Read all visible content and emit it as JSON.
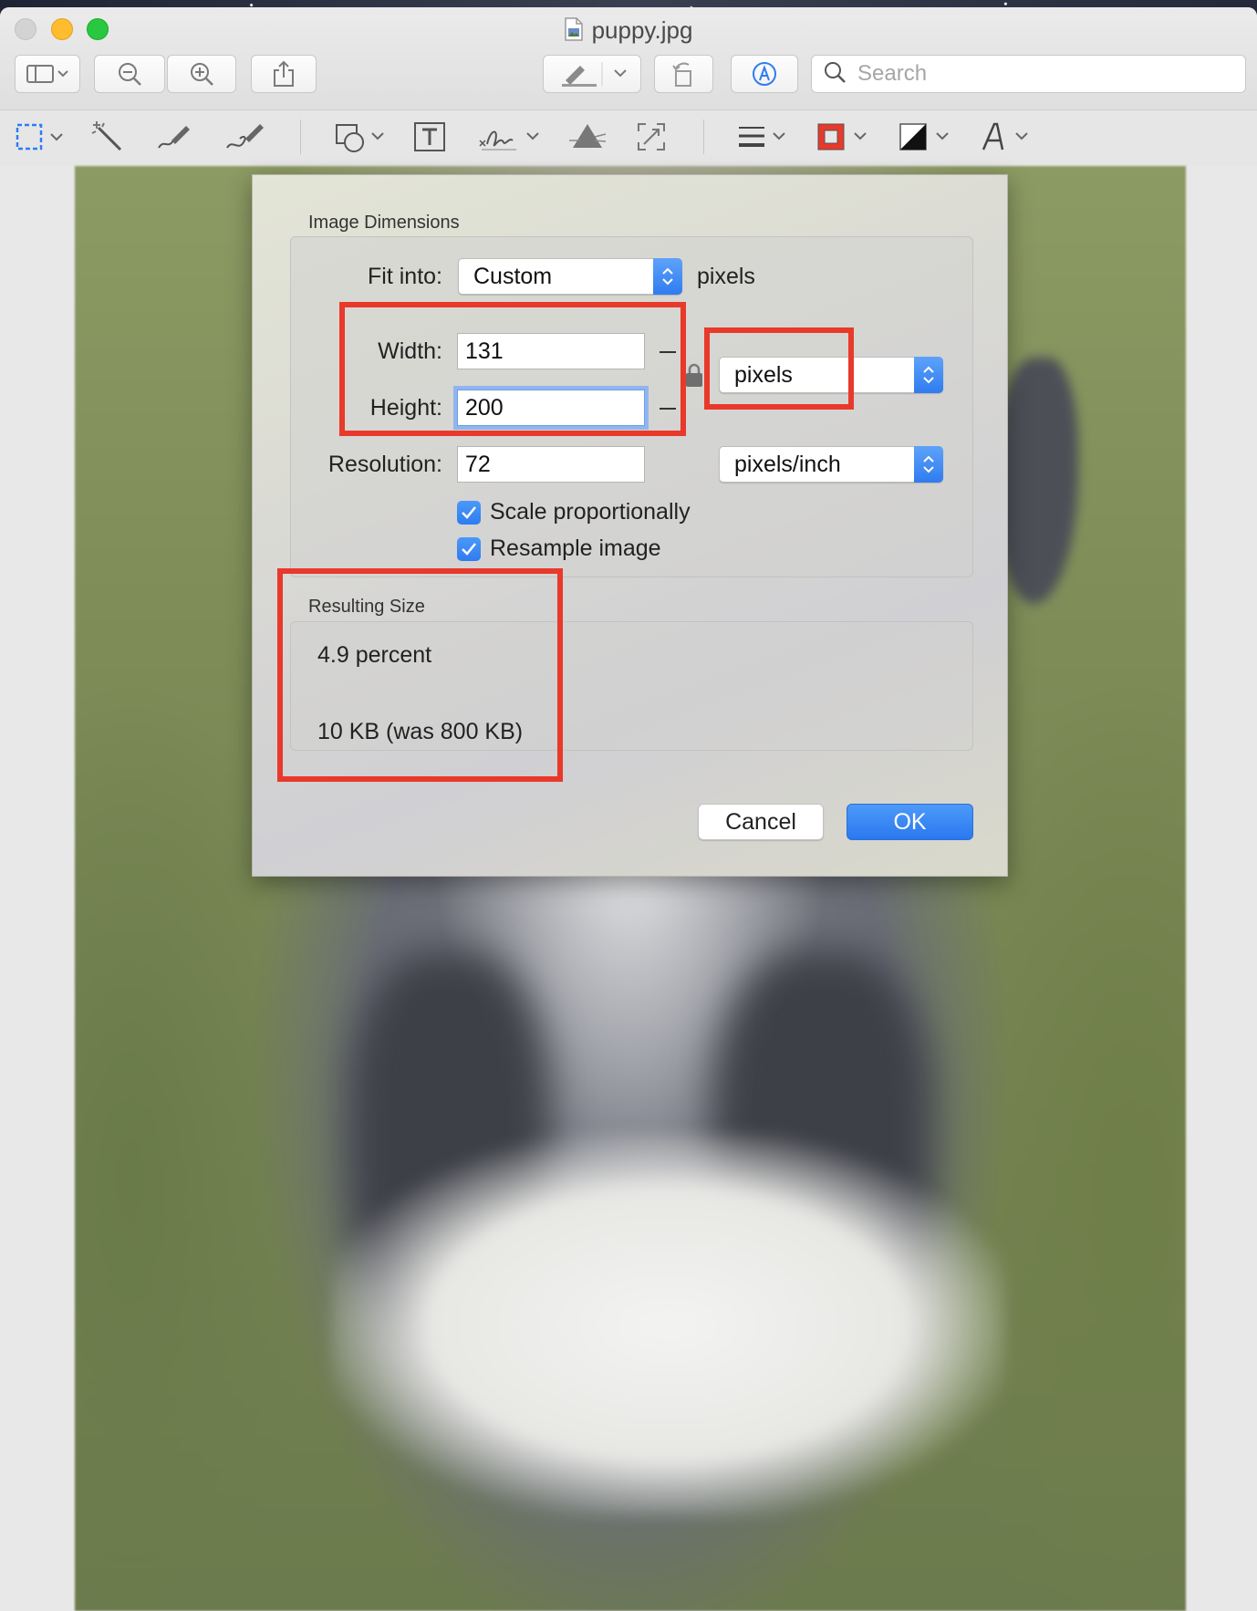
{
  "window": {
    "title": "puppy.jpg"
  },
  "toolbar": {
    "search_placeholder": "Search"
  },
  "dialog": {
    "image_dimensions_title": "Image Dimensions",
    "fit_into_label": "Fit into:",
    "fit_into_value": "Custom",
    "fit_into_unit": "pixels",
    "width_label": "Width:",
    "width_value": "131",
    "height_label": "Height:",
    "height_value": "200",
    "size_unit_value": "pixels",
    "resolution_label": "Resolution:",
    "resolution_value": "72",
    "resolution_unit_value": "pixels/inch",
    "scale_proportionally_label": "Scale proportionally",
    "scale_proportionally_checked": true,
    "resample_image_label": "Resample image",
    "resample_image_checked": true,
    "resulting_size_title": "Resulting Size",
    "result_percent": "4.9 percent",
    "result_filesize": "10 KB (was 800 KB)",
    "cancel_label": "Cancel",
    "ok_label": "OK"
  },
  "colors": {
    "accent": "#2f7cf0",
    "annotation_red": "#e8392a"
  },
  "icons": {
    "sidebar": "sidebar-icon",
    "zoom_out": "zoom-out-icon",
    "zoom_in": "zoom-in-icon",
    "share": "share-icon",
    "markup_pen": "pen-icon",
    "rotate": "rotate-icon",
    "markup_toolbar": "markup-icon",
    "search": "search-icon"
  }
}
